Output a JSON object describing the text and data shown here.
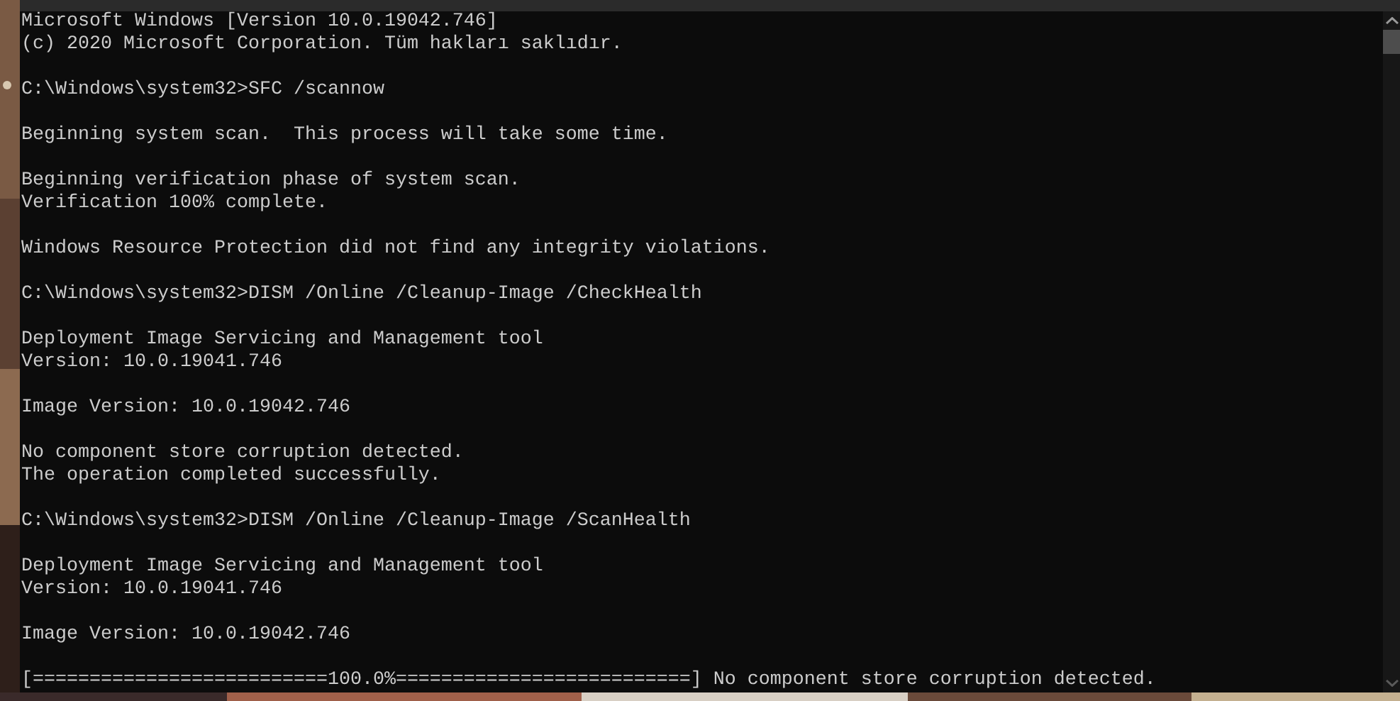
{
  "console": {
    "blocks": [
      [
        "Microsoft Windows [Version 10.0.19042.746]",
        "(c) 2020 Microsoft Corporation. Tüm hakları saklıdır."
      ],
      [
        "C:\\Windows\\system32>SFC /scannow"
      ],
      [
        "Beginning system scan.  This process will take some time."
      ],
      [
        "Beginning verification phase of system scan.",
        "Verification 100% complete."
      ],
      [
        "Windows Resource Protection did not find any integrity violations."
      ],
      [
        "C:\\Windows\\system32>DISM /Online /Cleanup-Image /CheckHealth"
      ],
      [
        "Deployment Image Servicing and Management tool",
        "Version: 10.0.19041.746"
      ],
      [
        "Image Version: 10.0.19042.746"
      ],
      [
        "No component store corruption detected.",
        "The operation completed successfully."
      ],
      [
        "C:\\Windows\\system32>DISM /Online /Cleanup-Image /ScanHealth"
      ],
      [
        "Deployment Image Servicing and Management tool",
        "Version: 10.0.19041.746"
      ],
      [
        "Image Version: 10.0.19042.746"
      ],
      [
        "[==========================100.0%==========================] No component store corruption detected."
      ]
    ]
  }
}
